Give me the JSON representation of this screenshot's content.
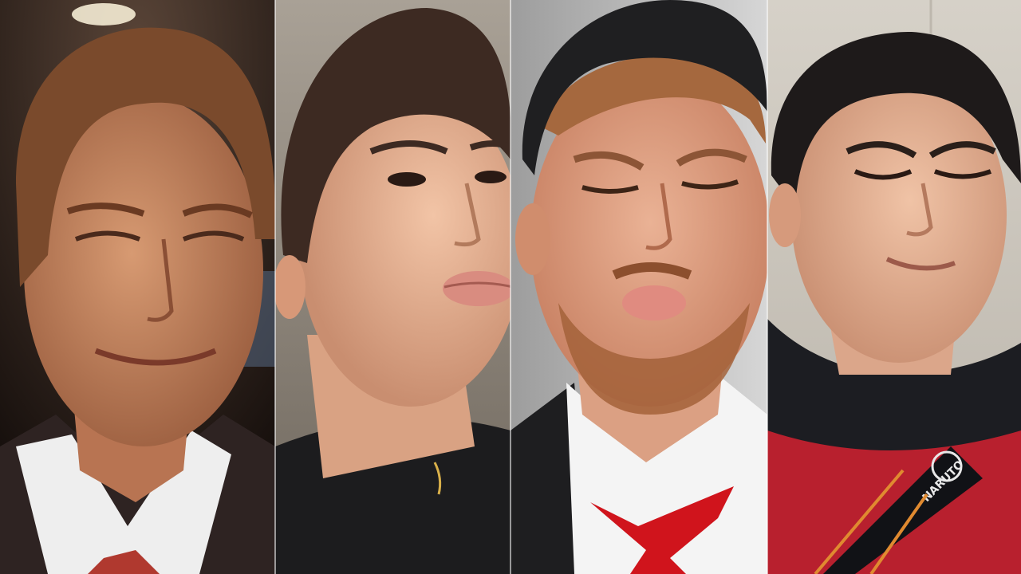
{
  "collage": {
    "panel_count": 4,
    "panels": [
      {
        "subject": "man-in-suit-smirking",
        "background": "#2a1c16",
        "skin": "#c78863",
        "hair": "#7a4a2c",
        "clothing": "#3a2a28"
      },
      {
        "subject": "young-man-pouting",
        "background": "#8a8175",
        "skin": "#e7b394",
        "hair": "#3d2a22",
        "clothing": "#1c1c1e"
      },
      {
        "subject": "man-in-cap-pouting-eyes-closed",
        "background": "#bcbcbc",
        "skin": "#e0a587",
        "hair": "#a5683e",
        "clothing": "#f2f2f2"
      },
      {
        "subject": "young-man-squinting-smile",
        "background": "#cfcac2",
        "skin": "#e4b497",
        "hair": "#1e1a1a",
        "clothing": "#b8202e"
      }
    ],
    "strap_text": "NARUTO"
  }
}
